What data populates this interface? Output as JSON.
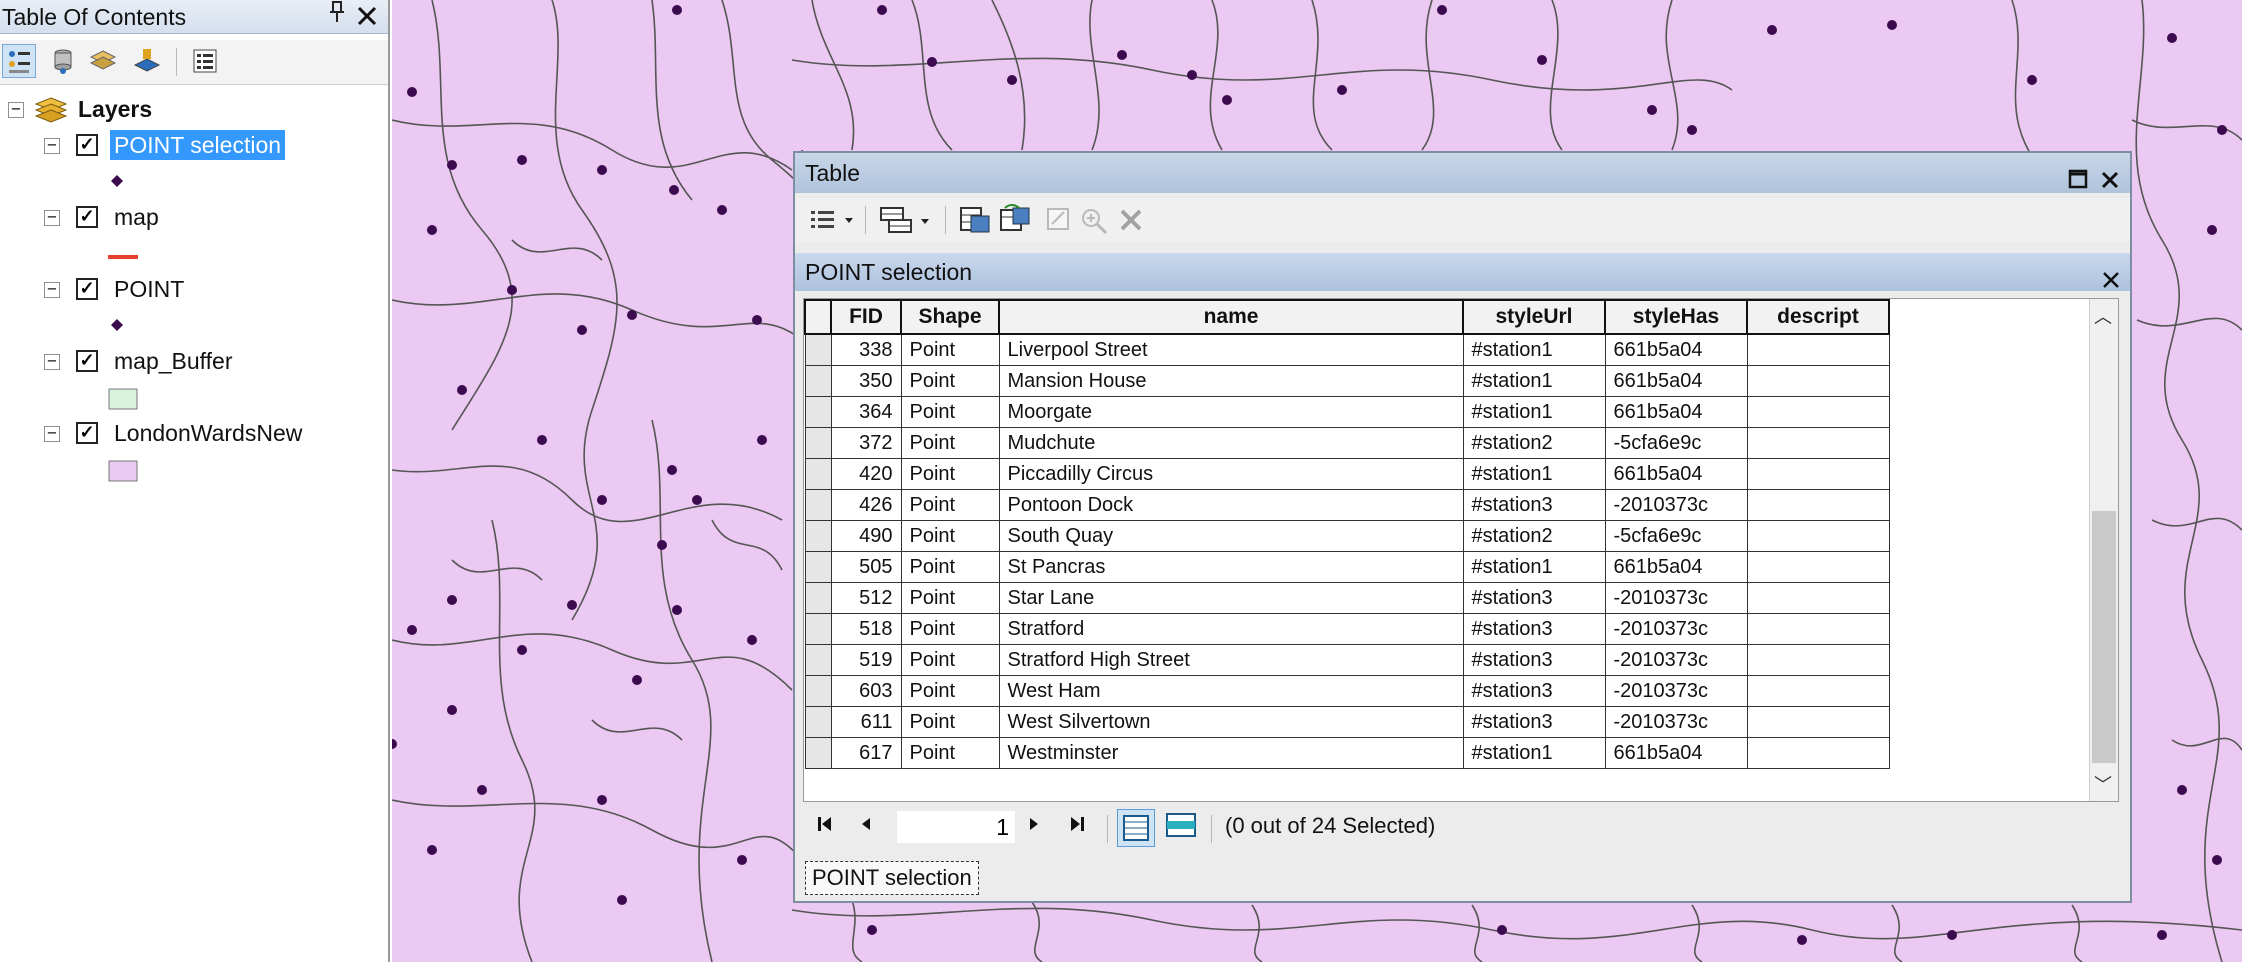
{
  "toc": {
    "title": "Table Of Contents",
    "pin_glyph": "ᵖ",
    "close_glyph": "✕",
    "root_label": "Layers",
    "layers": [
      {
        "label": "POINT selection",
        "checked": true,
        "selected": true,
        "symbol": "point"
      },
      {
        "label": "map",
        "checked": true,
        "selected": false,
        "symbol": "line"
      },
      {
        "label": "POINT",
        "checked": true,
        "selected": false,
        "symbol": "point"
      },
      {
        "label": "map_Buffer",
        "checked": true,
        "selected": false,
        "symbol": "fill-green"
      },
      {
        "label": "LondonWardsNew",
        "checked": true,
        "selected": false,
        "symbol": "fill-purple"
      }
    ]
  },
  "colors": {
    "map_fill": "#ebc9f2",
    "boundary": "#555555",
    "point": "#3b0a4f",
    "selection": "#3399ff",
    "line_symbol": "#e8402a",
    "buffer_fill": "#d8f2dc",
    "wards_fill": "#e9c8f1"
  },
  "table": {
    "window_title": "Table",
    "tab_title": "POINT selection",
    "columns": [
      "FID",
      "Shape",
      "name",
      "styleUrl",
      "styleHas",
      "descript"
    ],
    "rows": [
      [
        "338",
        "Point",
        "Liverpool Street",
        "#station1",
        "661b5a04",
        ""
      ],
      [
        "350",
        "Point",
        "Mansion House",
        "#station1",
        "661b5a04",
        ""
      ],
      [
        "364",
        "Point",
        "Moorgate",
        "#station1",
        "661b5a04",
        ""
      ],
      [
        "372",
        "Point",
        "Mudchute",
        "#station2",
        "-5cfa6e9c",
        ""
      ],
      [
        "420",
        "Point",
        "Piccadilly Circus",
        "#station1",
        "661b5a04",
        ""
      ],
      [
        "426",
        "Point",
        "Pontoon Dock",
        "#station3",
        "-2010373c",
        ""
      ],
      [
        "490",
        "Point",
        "South Quay",
        "#station2",
        "-5cfa6e9c",
        ""
      ],
      [
        "505",
        "Point",
        "St Pancras",
        "#station1",
        "661b5a04",
        ""
      ],
      [
        "512",
        "Point",
        "Star Lane",
        "#station3",
        "-2010373c",
        ""
      ],
      [
        "518",
        "Point",
        "Stratford",
        "#station3",
        "-2010373c",
        ""
      ],
      [
        "519",
        "Point",
        "Stratford High Street",
        "#station3",
        "-2010373c",
        ""
      ],
      [
        "603",
        "Point",
        "West Ham",
        "#station3",
        "-2010373c",
        ""
      ],
      [
        "611",
        "Point",
        "West Silvertown",
        "#station3",
        "-2010373c",
        ""
      ],
      [
        "617",
        "Point",
        "Westminster",
        "#station1",
        "661b5a04",
        ""
      ]
    ],
    "page_number": "1",
    "selection_status": "(0 out of 24 Selected)",
    "bottom_tab": "POINT selection"
  }
}
